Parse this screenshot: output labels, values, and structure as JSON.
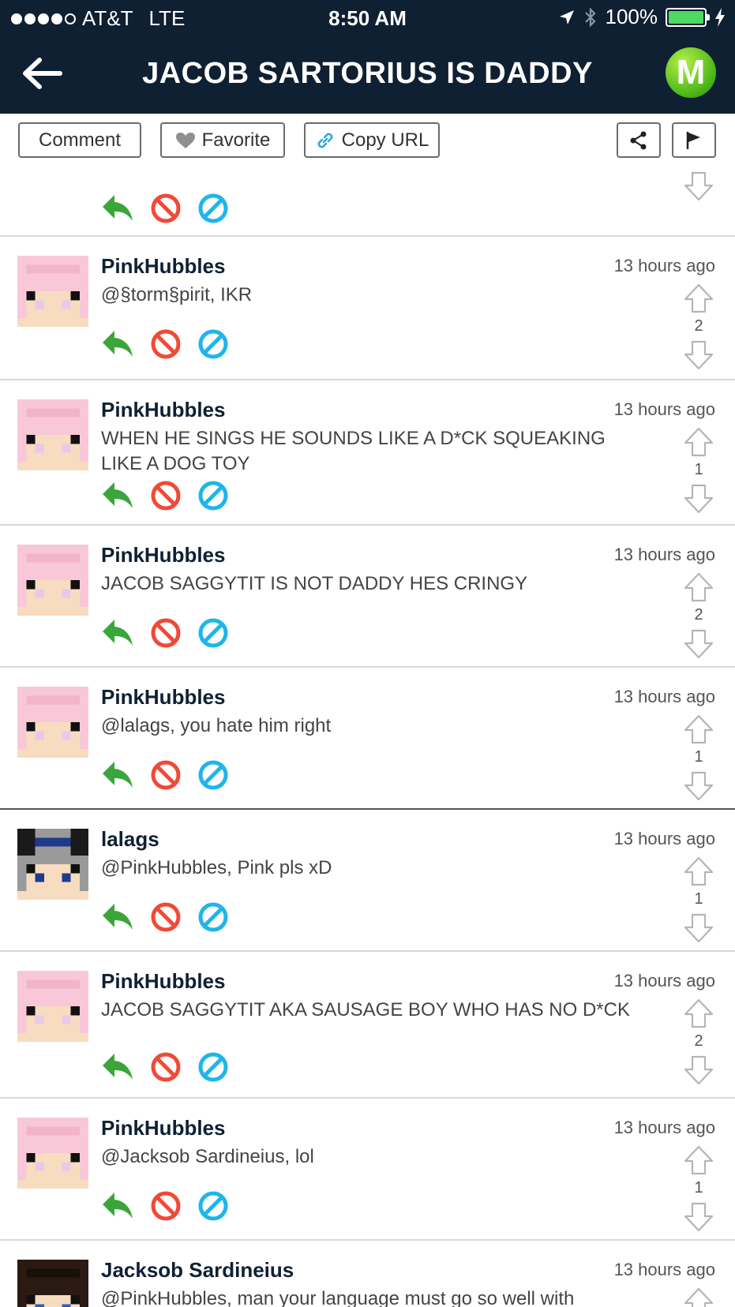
{
  "status_bar": {
    "carrier": "AT&T",
    "network": "LTE",
    "time": "8:50 AM",
    "battery": "100%",
    "signal_bars": 4
  },
  "nav": {
    "title": "JACOB SARTORIUS IS DADDY",
    "logo_letter": "M"
  },
  "toolbar": {
    "comment_label": "Comment",
    "favorite_label": "Favorite",
    "copy_url_label": "Copy URL"
  },
  "colors": {
    "header_bg": "#0f2033",
    "reply_green": "#3aa63a",
    "block_red": "#f04a36",
    "hide_blue": "#1eb6ea",
    "logo_green": "#4fb81a",
    "username": "#0f2033"
  },
  "comments": [
    {
      "user": "PinkHubbles",
      "time": "13 hours ago",
      "text": "@§torm§pirit, IKR",
      "votes": "2",
      "avatar": "pink-hair"
    },
    {
      "user": "PinkHubbles",
      "time": "13 hours ago",
      "text": "WHEN HE SINGS HE SOUNDS LIKE A D*CK SQUEAKING LIKE A DOG TOY",
      "votes": "1",
      "avatar": "pink-hair"
    },
    {
      "user": "PinkHubbles",
      "time": "13 hours ago",
      "text": "JACOB SAGGYTIT IS NOT DADDY HES CRINGY",
      "votes": "2",
      "avatar": "pink-hair"
    },
    {
      "user": "PinkHubbles",
      "time": "13 hours ago",
      "text": "@lalags, you hate him right",
      "votes": "1",
      "avatar": "pink-hair"
    },
    {
      "user": "lalags",
      "time": "13 hours ago",
      "text": "@PinkHubbles, Pink pls xD",
      "votes": "1",
      "avatar": "grey-hair"
    },
    {
      "user": "PinkHubbles",
      "time": "13 hours ago",
      "text": "JACOB SAGGYTIT AKA SAUSAGE BOY WHO HAS NO D*CK",
      "votes": "2",
      "avatar": "pink-hair"
    },
    {
      "user": "PinkHubbles",
      "time": "13 hours ago",
      "text": "@Jacksob Sardineius, lol",
      "votes": "1",
      "avatar": "pink-hair"
    },
    {
      "user": "Jacksob Sardineius",
      "time": "13 hours ago",
      "text": "@PinkHubbles, man your language must go so well with",
      "votes": "",
      "avatar": "brown-hair"
    }
  ]
}
